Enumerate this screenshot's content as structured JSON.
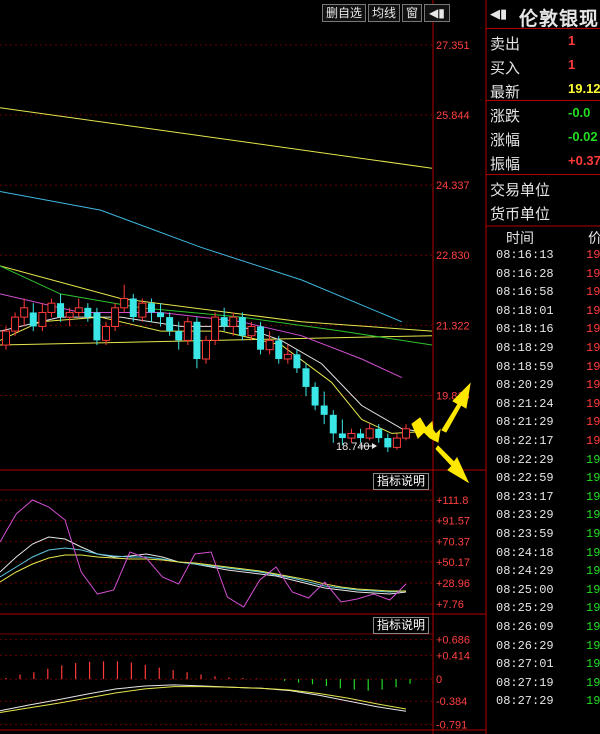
{
  "toolbar": {
    "buttons": [
      "删自选",
      "均线",
      "窗"
    ],
    "play_icon": "play-triangle-icon",
    "expand_icon": "play-triangle-icon"
  },
  "stock_name": "伦敦银现",
  "quote_panel": {
    "rows": [
      {
        "label": "卖出",
        "value": "1",
        "color": "#ff3a3a"
      },
      {
        "label": "买入",
        "value": "1",
        "color": "#ff3a3a"
      },
      {
        "label": "最新",
        "value": "19.12",
        "color": "#ffff33"
      },
      {
        "label": "涨跌",
        "value": "-0.0",
        "color": "#22dd22"
      },
      {
        "label": "涨幅",
        "value": "-0.02",
        "color": "#22dd22"
      },
      {
        "label": "振幅",
        "value": "+0.37",
        "color": "#ff3a3a"
      },
      {
        "label": "交易单位",
        "value": "",
        "color": "#e6e6e6"
      },
      {
        "label": "货币单位",
        "value": "",
        "color": "#e6e6e6"
      }
    ]
  },
  "trades_header": {
    "time": "时间",
    "price": "价"
  },
  "trades": [
    {
      "time": "08:16:13",
      "price": "19",
      "color": "#ff3a3a"
    },
    {
      "time": "08:16:28",
      "price": "19",
      "color": "#ff3a3a"
    },
    {
      "time": "08:16:58",
      "price": "19",
      "color": "#ff3a3a"
    },
    {
      "time": "08:18:01",
      "price": "19",
      "color": "#ff3a3a"
    },
    {
      "time": "08:18:16",
      "price": "19",
      "color": "#ff3a3a"
    },
    {
      "time": "08:18:29",
      "price": "19",
      "color": "#ff3a3a"
    },
    {
      "time": "08:18:59",
      "price": "19",
      "color": "#ff3a3a"
    },
    {
      "time": "08:20:29",
      "price": "19",
      "color": "#ff3a3a"
    },
    {
      "time": "08:21:24",
      "price": "19",
      "color": "#ff3a3a"
    },
    {
      "time": "08:21:29",
      "price": "19",
      "color": "#ff3a3a"
    },
    {
      "time": "08:22:17",
      "price": "19",
      "color": "#ff3a3a"
    },
    {
      "time": "08:22:29",
      "price": "19",
      "color": "#22dd22"
    },
    {
      "time": "08:22:59",
      "price": "19",
      "color": "#22dd22"
    },
    {
      "time": "08:23:17",
      "price": "19",
      "color": "#22dd22"
    },
    {
      "time": "08:23:29",
      "price": "19",
      "color": "#22dd22"
    },
    {
      "time": "08:23:59",
      "price": "19",
      "color": "#22dd22"
    },
    {
      "time": "08:24:18",
      "price": "19",
      "color": "#22dd22"
    },
    {
      "time": "08:24:29",
      "price": "19",
      "color": "#22dd22"
    },
    {
      "time": "08:25:00",
      "price": "19",
      "color": "#22dd22"
    },
    {
      "time": "08:25:29",
      "price": "19",
      "color": "#22dd22"
    },
    {
      "time": "08:26:09",
      "price": "19",
      "color": "#22dd22"
    },
    {
      "time": "08:26:29",
      "price": "19",
      "color": "#22dd22"
    },
    {
      "time": "08:27:01",
      "price": "19",
      "color": "#22dd22"
    },
    {
      "time": "08:27:19",
      "price": "19",
      "color": "#22dd22"
    },
    {
      "time": "08:27:29",
      "price": "19",
      "color": "#22dd22"
    }
  ],
  "chart_data": [
    {
      "type": "candlestick",
      "title": "",
      "y_axis_ticks": [
        "27.351",
        "25.844",
        "24.337",
        "22.830",
        "21.322",
        "19.815"
      ],
      "ylim": [
        18.3,
        27.8
      ],
      "low_marker_label": "18.740",
      "candles": [
        {
          "o": 20.9,
          "c": 21.2,
          "h": 21.3,
          "l": 20.8
        },
        {
          "o": 21.2,
          "c": 21.5,
          "h": 21.6,
          "l": 21.1
        },
        {
          "o": 21.5,
          "c": 21.7,
          "h": 21.9,
          "l": 21.3
        },
        {
          "o": 21.6,
          "c": 21.3,
          "h": 21.8,
          "l": 21.2
        },
        {
          "o": 21.3,
          "c": 21.6,
          "h": 21.8,
          "l": 21.2
        },
        {
          "o": 21.6,
          "c": 21.8,
          "h": 21.9,
          "l": 21.5
        },
        {
          "o": 21.8,
          "c": 21.5,
          "h": 22.0,
          "l": 21.4
        },
        {
          "o": 21.5,
          "c": 21.6,
          "h": 21.7,
          "l": 21.3
        },
        {
          "o": 21.6,
          "c": 21.7,
          "h": 21.9,
          "l": 21.5
        },
        {
          "o": 21.7,
          "c": 21.5,
          "h": 21.8,
          "l": 21.4
        },
        {
          "o": 21.6,
          "c": 21.0,
          "h": 21.7,
          "l": 20.9
        },
        {
          "o": 21.0,
          "c": 21.3,
          "h": 21.4,
          "l": 20.9
        },
        {
          "o": 21.3,
          "c": 21.7,
          "h": 21.8,
          "l": 21.2
        },
        {
          "o": 21.7,
          "c": 21.9,
          "h": 22.2,
          "l": 21.6
        },
        {
          "o": 21.9,
          "c": 21.5,
          "h": 22.0,
          "l": 21.4
        },
        {
          "o": 21.5,
          "c": 21.8,
          "h": 21.9,
          "l": 21.4
        },
        {
          "o": 21.8,
          "c": 21.6,
          "h": 21.9,
          "l": 21.4
        },
        {
          "o": 21.6,
          "c": 21.5,
          "h": 21.8,
          "l": 21.3
        },
        {
          "o": 21.5,
          "c": 21.2,
          "h": 21.6,
          "l": 21.1
        },
        {
          "o": 21.2,
          "c": 21.0,
          "h": 21.4,
          "l": 20.8
        },
        {
          "o": 21.0,
          "c": 21.4,
          "h": 21.5,
          "l": 20.9
        },
        {
          "o": 21.4,
          "c": 20.6,
          "h": 21.5,
          "l": 20.4
        },
        {
          "o": 20.6,
          "c": 21.0,
          "h": 21.1,
          "l": 20.5
        },
        {
          "o": 21.0,
          "c": 21.5,
          "h": 21.6,
          "l": 20.9
        },
        {
          "o": 21.5,
          "c": 21.3,
          "h": 21.7,
          "l": 21.2
        },
        {
          "o": 21.3,
          "c": 21.5,
          "h": 21.6,
          "l": 21.1
        },
        {
          "o": 21.5,
          "c": 21.1,
          "h": 21.6,
          "l": 21.0
        },
        {
          "o": 21.1,
          "c": 21.3,
          "h": 21.4,
          "l": 21.0
        },
        {
          "o": 21.3,
          "c": 20.8,
          "h": 21.4,
          "l": 20.7
        },
        {
          "o": 20.8,
          "c": 21.0,
          "h": 21.2,
          "l": 20.7
        },
        {
          "o": 21.0,
          "c": 20.6,
          "h": 21.1,
          "l": 20.5
        },
        {
          "o": 20.6,
          "c": 20.7,
          "h": 20.9,
          "l": 20.5
        },
        {
          "o": 20.7,
          "c": 20.4,
          "h": 20.8,
          "l": 20.3
        },
        {
          "o": 20.4,
          "c": 20.0,
          "h": 20.5,
          "l": 19.8
        },
        {
          "o": 20.0,
          "c": 19.6,
          "h": 20.1,
          "l": 19.5
        },
        {
          "o": 19.6,
          "c": 19.4,
          "h": 19.9,
          "l": 19.2
        },
        {
          "o": 19.4,
          "c": 19.0,
          "h": 19.5,
          "l": 18.8
        },
        {
          "o": 19.0,
          "c": 18.9,
          "h": 19.3,
          "l": 18.74
        },
        {
          "o": 18.9,
          "c": 19.0,
          "h": 19.1,
          "l": 18.8
        },
        {
          "o": 19.0,
          "c": 18.9,
          "h": 19.1,
          "l": 18.8
        },
        {
          "o": 18.9,
          "c": 19.1,
          "h": 19.2,
          "l": 18.85
        },
        {
          "o": 19.1,
          "c": 18.9,
          "h": 19.2,
          "l": 18.8
        },
        {
          "o": 18.9,
          "c": 18.7,
          "h": 19.0,
          "l": 18.6
        },
        {
          "o": 18.7,
          "c": 18.9,
          "h": 19.0,
          "l": 18.65
        },
        {
          "o": 18.9,
          "c": 19.1,
          "h": 19.2,
          "l": 18.85
        }
      ],
      "lines": [
        {
          "name": "",
          "color": "#e6e64c",
          "points": [
            [
              0,
              26.0
            ],
            [
              43,
              24.7
            ]
          ]
        },
        {
          "name": "",
          "color": "#e6e64c",
          "points": [
            [
              0,
              20.9
            ],
            [
              43,
              21.1
            ]
          ]
        },
        {
          "name": "",
          "color": "#e6e64c",
          "points": [
            [
              0,
              22.6
            ],
            [
              12,
              21.9
            ],
            [
              30,
              21.4
            ],
            [
              43,
              21.2
            ]
          ]
        },
        {
          "name": "",
          "color": "#3fb8e0",
          "points": [
            [
              0,
              24.2
            ],
            [
              10,
              23.8
            ],
            [
              20,
              23.0
            ],
            [
              30,
              22.3
            ],
            [
              40,
              21.4
            ]
          ]
        },
        {
          "name": "",
          "color": "#2fc22f",
          "points": [
            [
              0,
              22.6
            ],
            [
              6,
              22.0
            ],
            [
              14,
              21.7
            ],
            [
              24,
              21.5
            ],
            [
              34,
              21.2
            ],
            [
              43,
              20.9
            ]
          ]
        },
        {
          "name": "",
          "color": "#d24fd2",
          "points": [
            [
              0,
              22.0
            ],
            [
              8,
              21.6
            ],
            [
              16,
              21.6
            ],
            [
              24,
              21.4
            ],
            [
              30,
              21.1
            ],
            [
              36,
              20.6
            ],
            [
              40,
              20.2
            ]
          ]
        },
        {
          "name": "",
          "color": "#e6e6e6",
          "points": [
            [
              0,
              21.2
            ],
            [
              6,
              21.5
            ],
            [
              12,
              21.5
            ],
            [
              18,
              21.3
            ],
            [
              24,
              21.3
            ],
            [
              28,
              21.0
            ],
            [
              32,
              20.5
            ],
            [
              36,
              19.6
            ],
            [
              40,
              19.1
            ],
            [
              43,
              19.0
            ]
          ]
        },
        {
          "name": "",
          "color": "#e6e64c",
          "points": [
            [
              0,
              21.0
            ],
            [
              4,
              21.4
            ],
            [
              10,
              21.5
            ],
            [
              16,
              21.2
            ],
            [
              22,
              21.2
            ],
            [
              28,
              20.9
            ],
            [
              33,
              20.1
            ],
            [
              36,
              19.3
            ],
            [
              39,
              19.0
            ],
            [
              43,
              19.05
            ]
          ]
        }
      ]
    },
    {
      "type": "line",
      "title": "",
      "label_button": "指标说明",
      "y_axis_ticks": [
        "+111.8",
        "+91.57",
        "+70.37",
        "+50.17",
        "+28.96",
        "+7.76"
      ],
      "ylim": [
        0,
        120
      ],
      "series": [
        {
          "name": "",
          "color": "#e6e6e6",
          "values": [
            40,
            55,
            68,
            75,
            73,
            65,
            58,
            55,
            56,
            58,
            55,
            50,
            48,
            45,
            42,
            40,
            38,
            36,
            32,
            28,
            24,
            22,
            20,
            19,
            18,
            20
          ]
        },
        {
          "name": "",
          "color": "#5fc8e0",
          "values": [
            35,
            45,
            55,
            62,
            64,
            62,
            58,
            56,
            55,
            55,
            53,
            50,
            48,
            46,
            44,
            42,
            40,
            37,
            34,
            30,
            26,
            24,
            22,
            21,
            20,
            21
          ]
        },
        {
          "name": "",
          "color": "#e6e64c",
          "values": [
            30,
            40,
            48,
            54,
            57,
            57,
            55,
            54,
            53,
            53,
            52,
            50,
            49,
            47,
            45,
            43,
            41,
            38,
            35,
            32,
            28,
            25,
            23,
            22,
            21,
            21
          ]
        },
        {
          "name": "",
          "color": "#d24fd2",
          "values": [
            70,
            98,
            112,
            105,
            92,
            40,
            18,
            22,
            60,
            54,
            35,
            28,
            58,
            60,
            15,
            5,
            32,
            45,
            20,
            14,
            30,
            10,
            13,
            18,
            12,
            28
          ]
        }
      ]
    },
    {
      "type": "bar",
      "title": "",
      "label_button": "指标说明",
      "y_axis_ticks": [
        "+0.686",
        "+0.414",
        "0",
        "-0.384",
        "-0.791"
      ],
      "ylim": [
        -0.85,
        0.75
      ],
      "bars": [
        0.02,
        0.08,
        0.12,
        0.18,
        0.24,
        0.28,
        0.3,
        0.31,
        0.31,
        0.29,
        0.25,
        0.2,
        0.16,
        0.12,
        0.08,
        0.05,
        0.03,
        0.02,
        0.01,
        0.0,
        -0.03,
        -0.06,
        -0.09,
        -0.12,
        -0.16,
        -0.18,
        -0.2,
        -0.18,
        -0.14,
        -0.08
      ],
      "series": [
        {
          "name": "",
          "color": "#e6e6e6",
          "values": [
            -0.55,
            -0.45,
            -0.36,
            -0.26,
            -0.17,
            -0.12,
            -0.1,
            -0.12,
            -0.14,
            -0.16,
            -0.2,
            -0.28,
            -0.38,
            -0.48,
            -0.56
          ]
        },
        {
          "name": "",
          "color": "#e6e64c",
          "values": [
            -0.58,
            -0.5,
            -0.42,
            -0.33,
            -0.24,
            -0.17,
            -0.13,
            -0.13,
            -0.14,
            -0.16,
            -0.19,
            -0.25,
            -0.33,
            -0.43,
            -0.52
          ]
        }
      ]
    }
  ]
}
